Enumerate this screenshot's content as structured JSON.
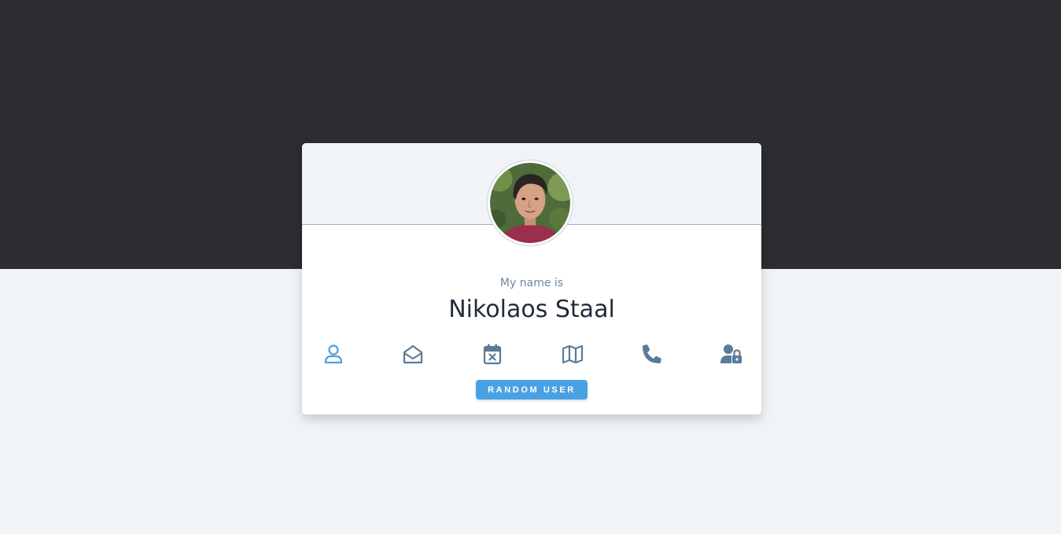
{
  "profile": {
    "title": "My name is",
    "value": "Nikolaos Staal",
    "avatar_alt": "Nikolaos Staal"
  },
  "tabs": [
    {
      "key": "name",
      "icon": "user-icon",
      "active": true
    },
    {
      "key": "email",
      "icon": "envelope-open-icon",
      "active": false
    },
    {
      "key": "birthday",
      "icon": "calendar-x-icon",
      "active": false
    },
    {
      "key": "location",
      "icon": "map-icon",
      "active": false
    },
    {
      "key": "phone",
      "icon": "phone-icon",
      "active": false
    },
    {
      "key": "password",
      "icon": "user-lock-icon",
      "active": false
    }
  ],
  "button": {
    "label": "RANDOM USER"
  },
  "colors": {
    "top_band": "#2c2d31",
    "page_bg": "#f0f4f7",
    "accent": "#49a1e4",
    "icon_inactive": "#5b7b99",
    "name_text": "#1f2d3d"
  }
}
